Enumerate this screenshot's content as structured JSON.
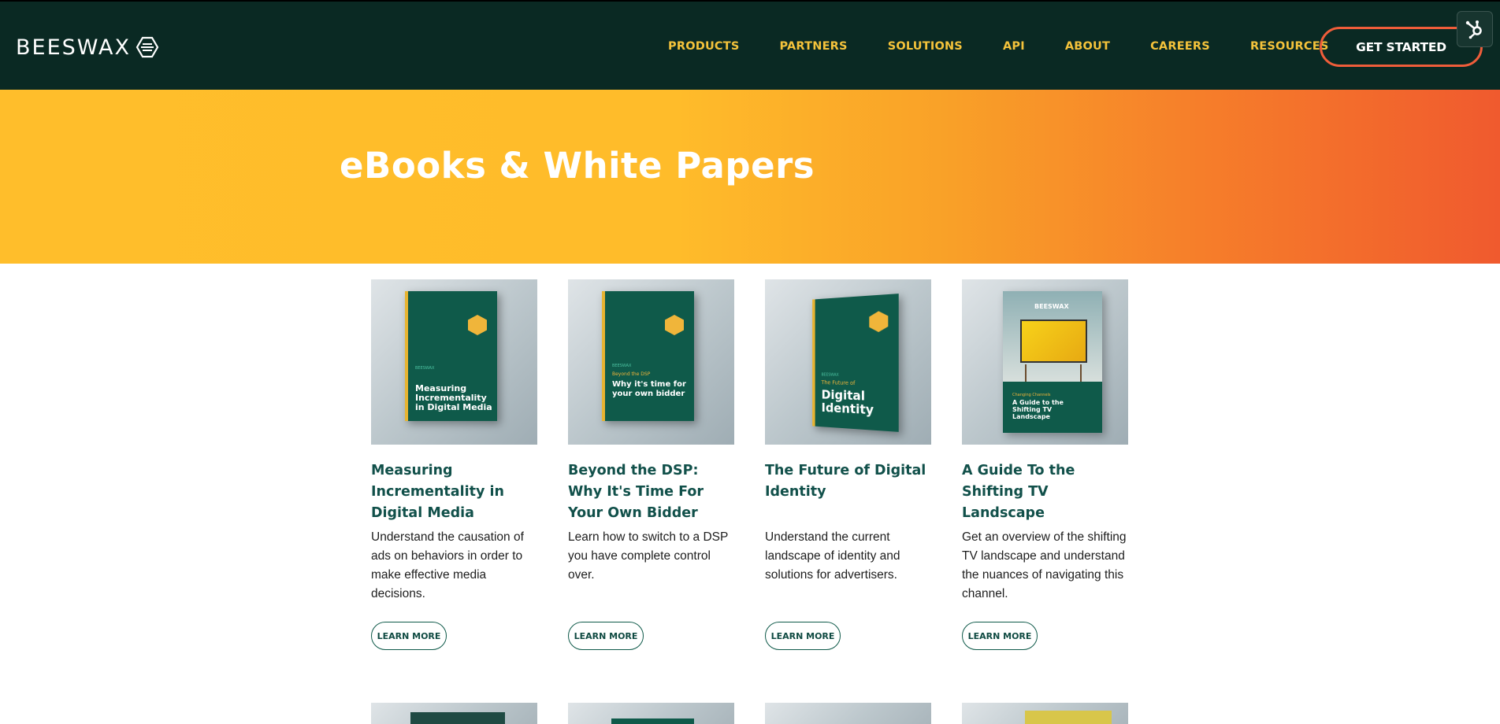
{
  "header": {
    "logo_text": "BEESWAX",
    "nav": [
      "PRODUCTS",
      "PARTNERS",
      "SOLUTIONS",
      "API",
      "ABOUT",
      "CAREERS",
      "RESOURCES"
    ],
    "cta_label": "GET STARTED",
    "bg_color": "#0a2923",
    "nav_color": "#f5c33b",
    "cta_border_color": "#ef5d3a"
  },
  "hero": {
    "title": "eBooks & White Papers"
  },
  "cards": [
    {
      "title": "Measuring Incrementality in Digital Media",
      "description": "Understand the causation of ads on behaviors in order to make effective media decisions.",
      "button": "LEARN MORE",
      "cover_title": "Measuring Incrementality in Digital Media",
      "cover_brand": "BEESWAX"
    },
    {
      "title": "Beyond the DSP: Why It's Time For Your Own Bidder",
      "description": "Learn how to switch to a DSP you have complete control over.",
      "button": "LEARN MORE",
      "cover_kicker": "Beyond the DSP",
      "cover_title": "Why it's time for your own bidder",
      "cover_brand": "BEESWAX"
    },
    {
      "title": "The Future of Digital Identity",
      "description": "Understand the current landscape of identity and solutions for advertisers.",
      "button": "LEARN MORE",
      "cover_kicker": "The Future of",
      "cover_title": "Digital Identity",
      "cover_brand": "BEESWAX"
    },
    {
      "title": "A Guide To the Shifting TV Landscape",
      "description": "Get an overview of the shifting TV landscape and understand the nuances of navigating this channel.",
      "button": "LEARN MORE",
      "cover_kicker": "Changing Channels",
      "cover_title": "A Guide to the Shifting TV Landscape",
      "cover_brand": "BEESWAX"
    }
  ]
}
